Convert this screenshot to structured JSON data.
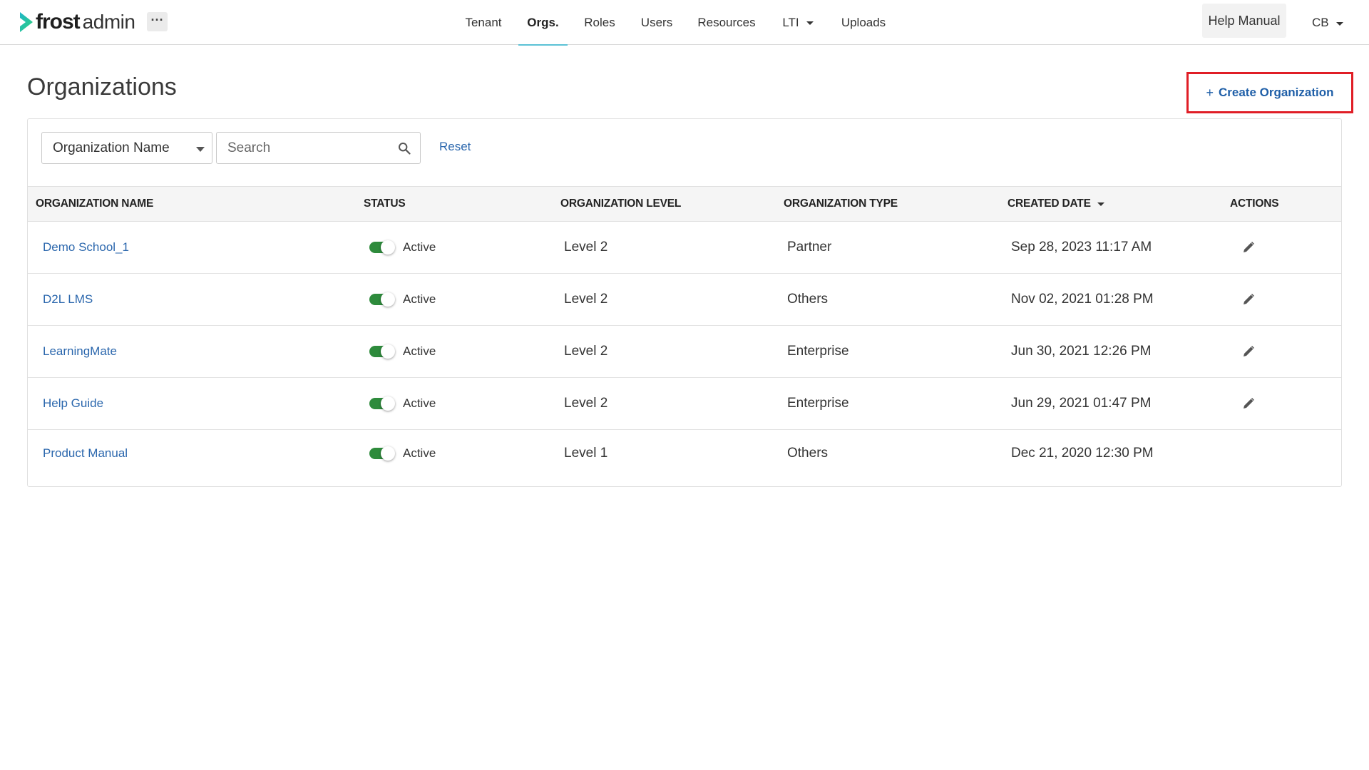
{
  "header": {
    "logo_frost": "frost",
    "logo_admin": "admin",
    "more_label": "···",
    "nav": [
      {
        "label": "Tenant",
        "active": false
      },
      {
        "label": "Orgs.",
        "active": true
      },
      {
        "label": "Roles",
        "active": false
      },
      {
        "label": "Users",
        "active": false
      },
      {
        "label": "Resources",
        "active": false
      },
      {
        "label": "LTI",
        "active": false,
        "has_dropdown": true
      },
      {
        "label": "Uploads",
        "active": false
      }
    ],
    "help_label": "Help Manual",
    "user_initials": "CB"
  },
  "page": {
    "title": "Organizations",
    "create_plus": "+",
    "create_label": "Create Organization"
  },
  "filters": {
    "field_selected": "Organization Name",
    "search_placeholder": "Search",
    "search_value": "",
    "reset_label": "Reset"
  },
  "table": {
    "columns": [
      "ORGANIZATION NAME",
      "STATUS",
      "ORGANIZATION LEVEL",
      "ORGANIZATION TYPE",
      "CREATED DATE",
      "ACTIONS"
    ],
    "sorted_column": "CREATED DATE",
    "rows": [
      {
        "name": "Demo School_1",
        "status": "Active",
        "level": "Level 2",
        "type": "Partner",
        "created": "Sep 28, 2023 11:17 AM",
        "editable": true
      },
      {
        "name": "D2L LMS",
        "status": "Active",
        "level": "Level 2",
        "type": "Others",
        "created": "Nov 02, 2021 01:28 PM",
        "editable": true
      },
      {
        "name": "LearningMate",
        "status": "Active",
        "level": "Level 2",
        "type": "Enterprise",
        "created": "Jun 30, 2021 12:26 PM",
        "editable": true
      },
      {
        "name": "Help Guide",
        "status": "Active",
        "level": "Level 2",
        "type": "Enterprise",
        "created": "Jun 29, 2021 01:47 PM",
        "editable": true
      },
      {
        "name": "Product Manual",
        "status": "Active",
        "level": "Level 1",
        "type": "Others",
        "created": "Dec 21, 2020 12:30 PM",
        "editable": false
      }
    ]
  },
  "colors": {
    "accent_link": "#2b67ad",
    "nav_active_underline": "#5bc2d6",
    "toggle_on": "#2e8b3c",
    "highlight_box": "#e01e26",
    "logo_green": "#27c48a"
  }
}
